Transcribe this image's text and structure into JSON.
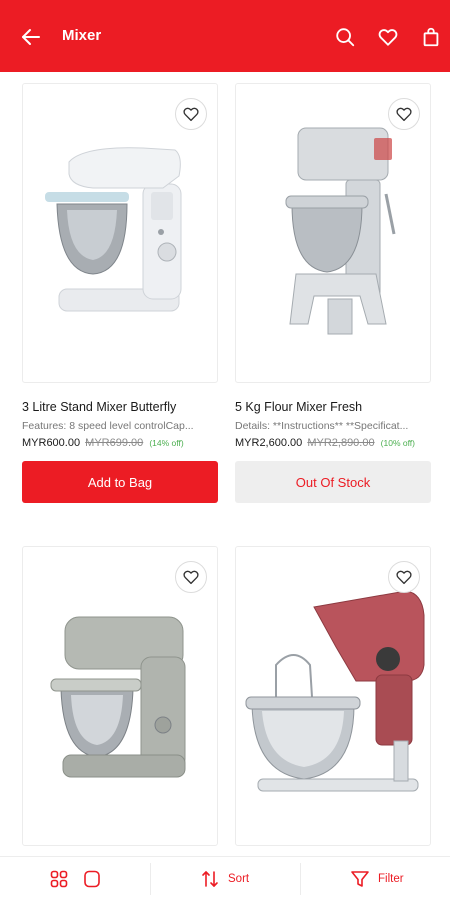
{
  "header": {
    "title": "Mixer",
    "icons": [
      "back-arrow-icon",
      "search-icon",
      "heart-icon",
      "shopping-bag-icon"
    ],
    "background": "#ec1c24"
  },
  "products": [
    {
      "name": "3 Litre Stand Mixer Butterfly",
      "description": "Features: 8 speed level controlCap...",
      "price": "MYR600.00",
      "original_price": "MYR699.00",
      "discount": "(14% off)",
      "action_label": "Add to Bag"
    },
    {
      "name": "5 Kg Flour Mixer Fresh",
      "description": "Details: **Instructions** **Specificat...",
      "price": "MYR2,600.00",
      "original_price": "MYR2,890.00",
      "discount": "(10% off)",
      "action_label": "Out Of Stock"
    },
    {
      "name": "",
      "description": ""
    },
    {
      "name": "",
      "description": ""
    }
  ],
  "bottom_bar": {
    "sort_label": "Sort",
    "filter_label": "Filter",
    "icons": [
      "grid-view-icon",
      "single-view-icon",
      "sort-icon",
      "filter-icon"
    ]
  },
  "colors": {
    "accent": "#ec1c24",
    "discount": "#4caf50",
    "out_of_stock_bg": "#eeeeee"
  }
}
